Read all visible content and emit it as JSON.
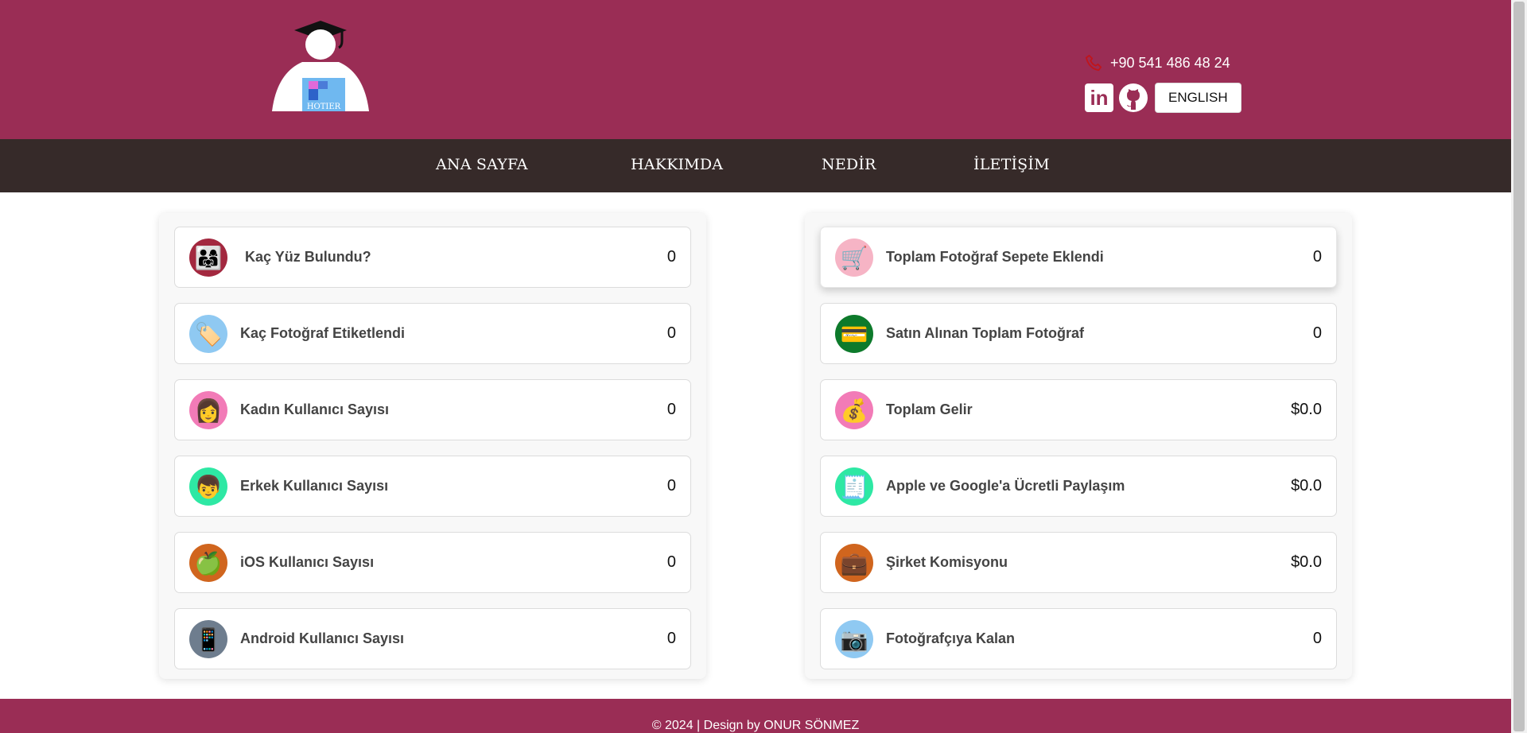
{
  "header": {
    "logo_text": "HOTIER",
    "phone": "+90 541 486 48 24",
    "language_button": "ENGLISH"
  },
  "nav": {
    "items": [
      {
        "label": "ANA SAYFA"
      },
      {
        "label": "HAKKIMDA"
      },
      {
        "label": "NEDİR"
      },
      {
        "label": "İLETİŞİM"
      }
    ]
  },
  "stats_left": [
    {
      "label": "Kaç Yüz Bulundu?",
      "value": "0",
      "icon": "family-icon",
      "color": "#a3283f"
    },
    {
      "label": "Kaç Fotoğraf Etiketlendi",
      "value": "0",
      "icon": "tag-icon",
      "color": "#8fc9f2"
    },
    {
      "label": "Kadın Kullanıcı Sayısı",
      "value": "0",
      "icon": "woman-icon",
      "color": "#f27bb7"
    },
    {
      "label": "Erkek Kullanıcı Sayısı",
      "value": "0",
      "icon": "man-icon",
      "color": "#2ee8a4"
    },
    {
      "label": "iOS Kullanıcı Sayısı",
      "value": "0",
      "icon": "apple-icon",
      "color": "#d0651e"
    },
    {
      "label": "Android Kullanıcı Sayısı",
      "value": "0",
      "icon": "phone-icon",
      "color": "#6e7d8e"
    }
  ],
  "stats_right": [
    {
      "label": "Toplam Fotoğraf Sepete Eklendi",
      "value": "0",
      "icon": "cart-icon",
      "color": "#f6b4c5"
    },
    {
      "label": "Satın Alınan Toplam Fotoğraf",
      "value": "0",
      "icon": "purchase-icon",
      "color": "#0d7a2b"
    },
    {
      "label": "Toplam Gelir",
      "value": "$0.0",
      "icon": "money-bag-icon",
      "color": "#f27bb7"
    },
    {
      "label": "Apple ve Google'a Ücretli Paylaşım",
      "value": "$0.0",
      "icon": "receipt-icon",
      "color": "#2ee8a4"
    },
    {
      "label": "Şirket Komisyonu",
      "value": "$0.0",
      "icon": "briefcase-icon",
      "color": "#d0651e"
    },
    {
      "label": "Fotoğrafçıya Kalan",
      "value": "0",
      "icon": "camera-icon",
      "color": "#8fc9f2"
    }
  ],
  "footer": {
    "text": "© 2024 | Design by ONUR SÖNMEZ"
  },
  "colors": {
    "header_bg": "#9a2d55",
    "nav_bg": "#362a29"
  }
}
